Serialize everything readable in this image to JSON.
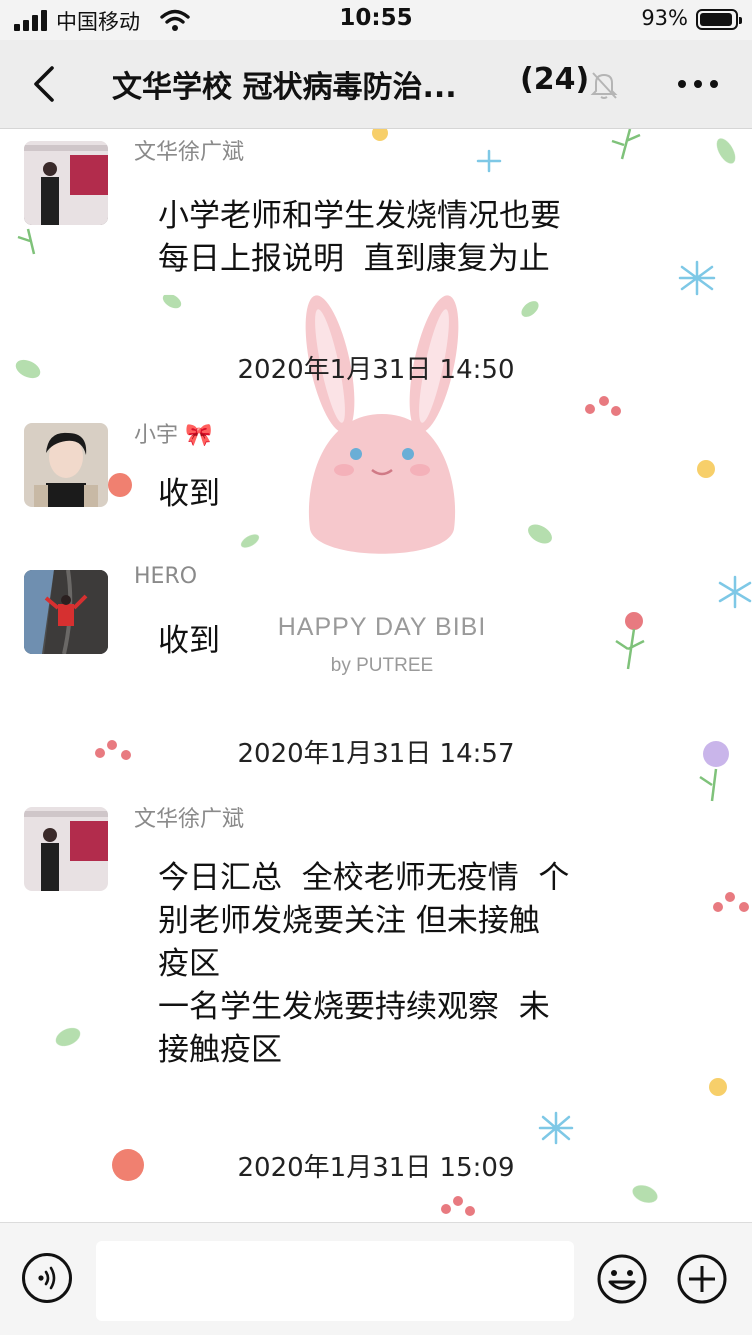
{
  "status_bar": {
    "carrier": "中国移动",
    "time": "10:55",
    "battery_percent": "93%",
    "battery_level": 0.93
  },
  "nav": {
    "title": "文华学校 冠状病毒防治...",
    "member_count": "(24)",
    "icons": [
      "back-arrow-icon",
      "mute-bell-icon",
      "more-dots-icon"
    ]
  },
  "chat": {
    "watermark": {
      "line1": "HAPPY DAY BIBI",
      "line2": "by PUTREE"
    },
    "messages": [
      {
        "sender": "文华徐广斌",
        "text": "小学老师和学生发烧情况也要\n每日上报说明  直到康复为止"
      },
      {
        "timestamp": "2020年1月31日 14:50"
      },
      {
        "sender": "小宇 🎀",
        "text": "收到"
      },
      {
        "sender": "HERO",
        "text": "收到"
      },
      {
        "timestamp": "2020年1月31日 14:57"
      },
      {
        "sender": "文华徐广斌",
        "text": "今日汇总  全校老师无疫情  个\n别老师发烧要关注 但未接触\n疫区\n一名学生发烧要持续观察  未\n接触疫区"
      },
      {
        "timestamp": "2020年1月31日 15:09"
      }
    ]
  },
  "input_bar": {
    "icons": [
      "voice-icon",
      "emoji-icon",
      "plus-icon"
    ]
  },
  "colors": {
    "nav_bg": "#ededed",
    "bubble_bg": "#ffffff",
    "bunny_pink": "#f6c8cc",
    "sender_gray": "#8a8a8a"
  }
}
